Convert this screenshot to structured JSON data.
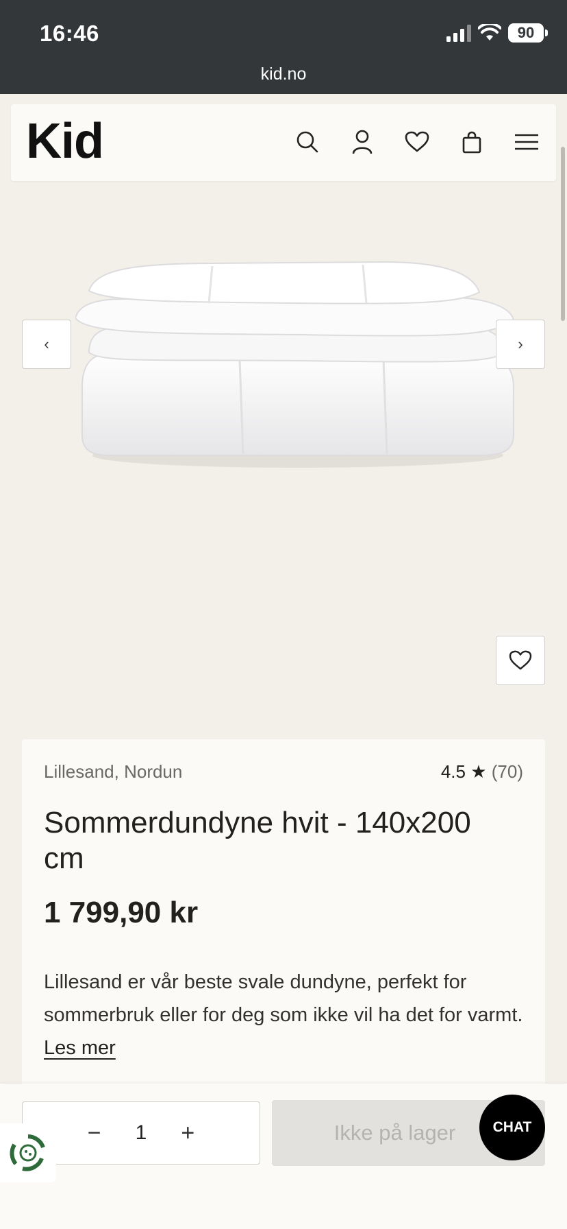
{
  "status_bar": {
    "time": "16:46",
    "battery": "90"
  },
  "browser": {
    "url": "kid.no"
  },
  "header": {
    "logo": "Kid",
    "icons": [
      "search-icon",
      "account-icon",
      "heart-icon",
      "bag-icon",
      "menu-icon"
    ]
  },
  "gallery": {
    "prev_icon": "‹",
    "next_icon": "›"
  },
  "product": {
    "brand": "Lillesand, Nordun",
    "rating_value": "4.5",
    "rating_star": "★",
    "rating_count": "(70)",
    "title": "Sommerdundyne hvit - 140x200 cm",
    "price": "1 799,90 kr",
    "description": "Lillesand er vår beste svale dundyne, perfekt for sommerbruk eller for deg som ikke vil ha det for varmt.",
    "read_more": "Les mer"
  },
  "purchase": {
    "minus": "−",
    "quantity": "1",
    "plus": "+",
    "stock_button": "Ikke på lager"
  },
  "chat": {
    "label": "CHAT"
  },
  "colors": {
    "chrome": "#34373a",
    "background": "#f3f0e9",
    "card": "#fbfaf6",
    "chat": "#000000"
  }
}
